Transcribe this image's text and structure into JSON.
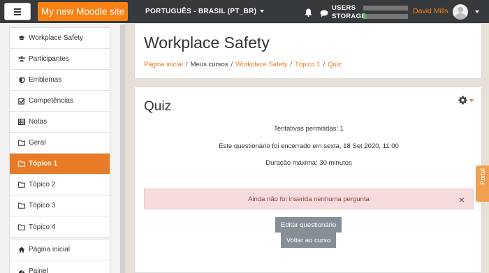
{
  "navbar": {
    "site_name": "My new Moodle site",
    "language": "PORTUGUÊS - BRASIL (PT_BR)",
    "usage": [
      {
        "label": "USERS",
        "fraction": 0.0
      },
      {
        "label": "STORAGE",
        "fraction": 0.06
      }
    ],
    "user_name": "David Mills",
    "icons": [
      "menu-icon",
      "bell-icon",
      "chat-icon",
      "avatar",
      "chevron-down-icon"
    ]
  },
  "sidebar": {
    "items": [
      {
        "label": "Workplace Safety",
        "icon": "graduation-cap-icon"
      },
      {
        "label": "Participantes",
        "icon": "users-icon"
      },
      {
        "label": "Emblemas",
        "icon": "shield-icon"
      },
      {
        "label": "Competências",
        "icon": "check-square-icon"
      },
      {
        "label": "Notas",
        "icon": "table-icon"
      },
      {
        "label": "Geral",
        "icon": "folder-icon"
      },
      {
        "label": "Tópico 1",
        "icon": "folder-icon",
        "active": true
      },
      {
        "label": "Tópico 2",
        "icon": "folder-icon"
      },
      {
        "label": "Tópico 3",
        "icon": "folder-icon"
      },
      {
        "label": "Tópico 4",
        "icon": "folder-icon"
      }
    ],
    "items2": [
      {
        "label": "Página inicial",
        "icon": "home-icon"
      },
      {
        "label": "Painel",
        "icon": "dashboard-icon"
      }
    ]
  },
  "header": {
    "title": "Workplace Safety",
    "breadcrumb": [
      "Página inicial",
      "Meus cursos",
      "Workplace Safety",
      "Tópico 1",
      "Quiz"
    ]
  },
  "main": {
    "title": "Quiz",
    "attempts": "Tentativas permitidas: 1",
    "closed": "Este questionário foi encerrado em sexta, 18 Set 2020, 11:00",
    "duration": "Duração máxima: 30 minutos",
    "alert": "Ainda não foi inserida nenhuma pergunta",
    "alert_close": "×",
    "btn_edit": "Editar questionário",
    "btn_back": "Voltar ao curso"
  },
  "portal_tab": "Portal",
  "colors": {
    "brand": "#f98012",
    "active": "#e97b26",
    "navbar": "#373a3c"
  }
}
